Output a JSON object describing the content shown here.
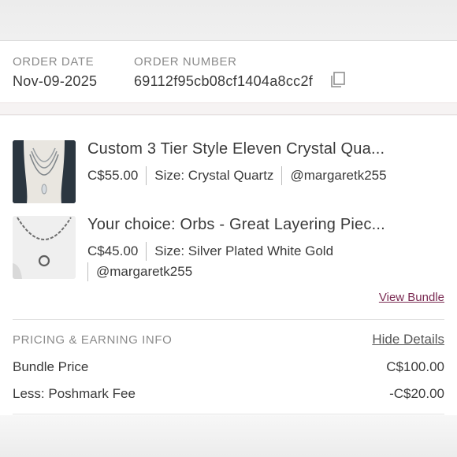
{
  "order": {
    "date_label": "ORDER DATE",
    "date_value": "Nov-09-2025",
    "number_label": "ORDER NUMBER",
    "number_value": "69112f95cb08cf1404a8cc2f",
    "copy_icon": "copy-icon"
  },
  "items": [
    {
      "title": "Custom 3 Tier Style Eleven Crystal Qua...",
      "price": "C$55.00",
      "size": "Size: Crystal Quartz",
      "seller": "@margaretk255"
    },
    {
      "title": "Your choice: Orbs - Great Layering Piec...",
      "price": "C$45.00",
      "size": "Size: Silver Plated White Gold",
      "seller": "@margaretk255"
    }
  ],
  "bundle": {
    "view_label": "View Bundle"
  },
  "pricing": {
    "heading": "PRICING & EARNING INFO",
    "toggle_label": "Hide Details",
    "rows": [
      {
        "label": "Bundle Price",
        "amount": "C$100.00"
      },
      {
        "label": "Less: Poshmark Fee",
        "amount": "-C$20.00"
      }
    ]
  },
  "colors": {
    "link": "#7a2a52",
    "label": "#8a8a8a",
    "text": "#3a3a3a"
  }
}
